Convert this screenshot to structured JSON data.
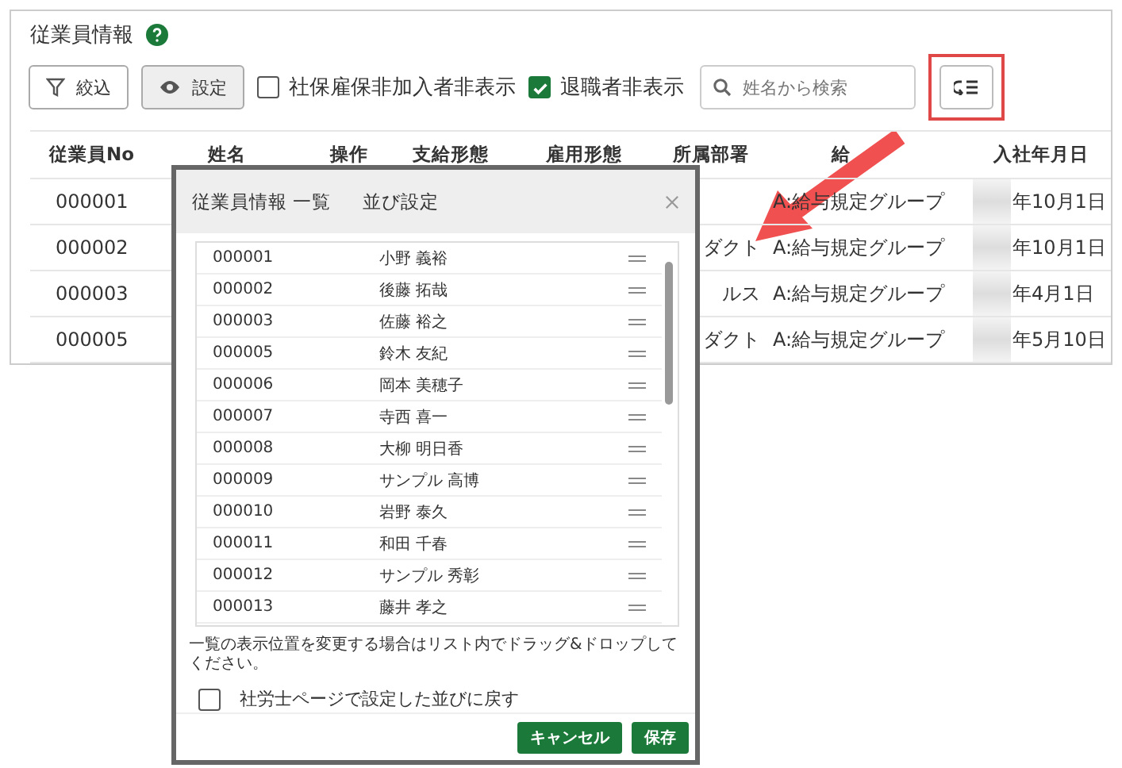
{
  "title": "従業員情報",
  "toolbar": {
    "filter_button": "絞込",
    "settings_button": "設定",
    "checkboxes": [
      {
        "label": "社保雇保非加入者非表示",
        "checked": false
      },
      {
        "label": "退職者非表示",
        "checked": true
      }
    ],
    "search": {
      "placeholder": "姓名から検索"
    },
    "sort_button": {
      "highlighted": true
    }
  },
  "table": {
    "columns": [
      "従業員No",
      "姓名",
      "操作",
      "支給形態",
      "雇用形態",
      "所属部署",
      "給",
      "入社年月日"
    ],
    "rows": [
      {
        "no": "000001",
        "salary_group": "A:給与規定グループ",
        "hire_date": "年10月1日"
      },
      {
        "no": "000002",
        "department": "ダクト",
        "salary_group": "A:給与規定グループ",
        "hire_date": "年10月1日"
      },
      {
        "no": "000003",
        "department": "ルス",
        "salary_group": "A:給与規定グループ",
        "hire_date": "年4月1日"
      },
      {
        "no": "000005",
        "department": "ダクト",
        "salary_group": "A:給与規定グループ",
        "hire_date": "年5月10日"
      }
    ]
  },
  "dialog": {
    "title": "従業員情報 一覧",
    "subtitle": "並び設定",
    "items": [
      {
        "no": "000001",
        "name": "小野 義裕"
      },
      {
        "no": "000002",
        "name": "後藤 拓哉"
      },
      {
        "no": "000003",
        "name": "佐藤 裕之"
      },
      {
        "no": "000005",
        "name": "鈴木 友紀"
      },
      {
        "no": "000006",
        "name": "岡本 美穂子"
      },
      {
        "no": "000007",
        "name": "寺西 喜一"
      },
      {
        "no": "000008",
        "name": "大柳 明日香"
      },
      {
        "no": "000009",
        "name": "サンプル 高博"
      },
      {
        "no": "000010",
        "name": "岩野 泰久"
      },
      {
        "no": "000011",
        "name": "和田 千春"
      },
      {
        "no": "000012",
        "name": "サンプル 秀彰"
      },
      {
        "no": "000013",
        "name": "藤井 孝之"
      }
    ],
    "hint": "一覧の表示位置を変更する場合はリスト内でドラッグ&ドロップしてください。",
    "reset_option": {
      "label": "社労士ページで設定した並びに戻す",
      "checked": false
    },
    "buttons": [
      "キャンセル",
      "保存"
    ]
  }
}
